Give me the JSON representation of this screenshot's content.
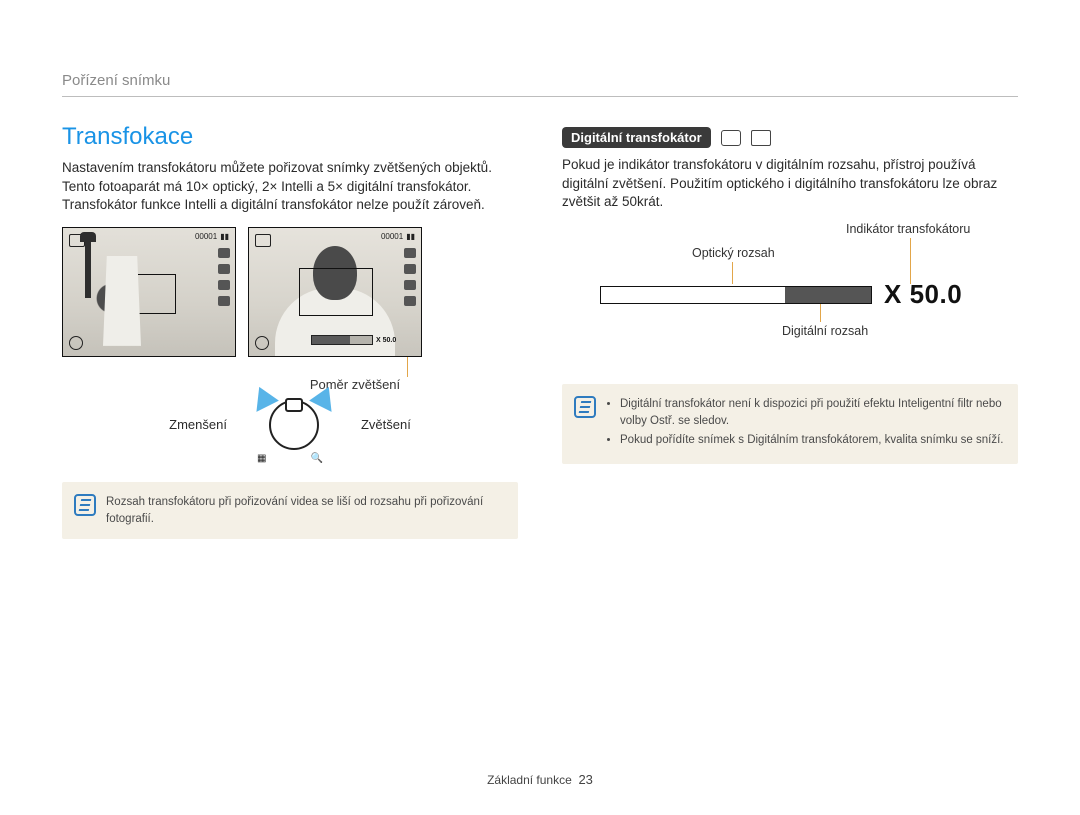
{
  "header": {
    "breadcrumb": "Pořízení snímku"
  },
  "left": {
    "title": "Transfokace",
    "body": "Nastavením transfokátoru můžete pořizovat snímky zvětšených objektů. Tento fotoaparát má 10× optický, 2× Intelli a 5× digitální transfokátor. Transfokátor funkce Intelli a digitální transfokátor nelze použít zároveň.",
    "screen_counter": "00001",
    "screen_zoom_val": "X 50.0",
    "ratio_caption": "Poměr zvětšení",
    "zoom_out": "Zmenšení",
    "zoom_in": "Zvětšení",
    "note": "Rozsah transfokátoru při pořizování videa se liší od rozsahu při pořizování fotografií."
  },
  "right": {
    "badge": "Digitální transfokátor",
    "body": "Pokud je indikátor transfokátoru v digitálním rozsahu, přístroj používá digitální zvětšení. Použitím optického i digitálního transfokátoru lze obraz zvětšit až 50krát.",
    "indicator_label": "Indikátor transfokátoru",
    "optical_label": "Optický rozsah",
    "digital_label": "Digitální rozsah",
    "x_value": "X 50.0",
    "notes": [
      "Digitální transfokátor není k dispozici při použití efektu Inteligentní filtr nebo volby Ostř. se sledov.",
      "Pokud pořídíte snímek s Digitálním transfokátorem, kvalita snímku se sníží."
    ]
  },
  "footer": {
    "section": "Základní funkce",
    "page": "23"
  }
}
